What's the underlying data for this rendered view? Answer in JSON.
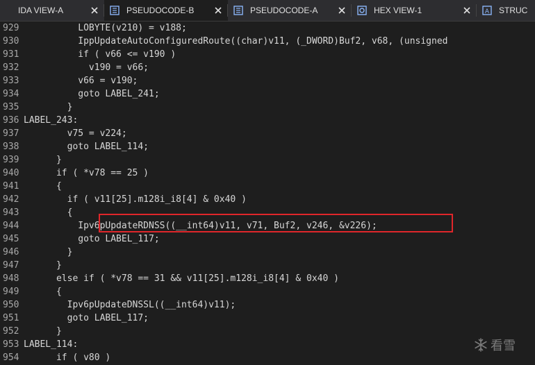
{
  "tabs": [
    {
      "label": "IDA VIEW-A",
      "icon": "ida-view-icon",
      "active": false
    },
    {
      "label": "PSEUDOCODE-B",
      "icon": "pseudocode-icon",
      "active": true
    },
    {
      "label": "PSEUDOCODE-A",
      "icon": "pseudocode-icon",
      "active": false
    },
    {
      "label": "HEX VIEW-1",
      "icon": "hex-view-icon",
      "active": false
    },
    {
      "label": "STRUC",
      "icon": "structures-icon",
      "active": false
    }
  ],
  "code_lines": [
    {
      "n": "929",
      "text": "          LOBYTE(v210) = v188;"
    },
    {
      "n": "930",
      "text": "          IppUpdateAutoConfiguredRoute((char)v11, (_DWORD)Buf2, v68, (unsigned"
    },
    {
      "n": "931",
      "text": "          if ( v66 <= v190 )"
    },
    {
      "n": "932",
      "text": "            v190 = v66;"
    },
    {
      "n": "933",
      "text": "          v66 = v190;"
    },
    {
      "n": "934",
      "text": "          goto LABEL_241;"
    },
    {
      "n": "935",
      "text": "        }"
    },
    {
      "n": "936",
      "text": "LABEL_243:"
    },
    {
      "n": "937",
      "text": "        v75 = v224;"
    },
    {
      "n": "938",
      "text": "        goto LABEL_114;"
    },
    {
      "n": "939",
      "text": "      }"
    },
    {
      "n": "940",
      "text": "      if ( *v78 == 25 )"
    },
    {
      "n": "941",
      "text": "      {"
    },
    {
      "n": "942",
      "text": "        if ( v11[25].m128i_i8[4] & 0x40 )"
    },
    {
      "n": "943",
      "text": "        {"
    },
    {
      "n": "944",
      "text": "          Ipv6pUpdateRDNSS((__int64)v11, v71, Buf2, v246, &v226);"
    },
    {
      "n": "945",
      "text": "          goto LABEL_117;"
    },
    {
      "n": "946",
      "text": "        }"
    },
    {
      "n": "947",
      "text": "      }"
    },
    {
      "n": "948",
      "text": "      else if ( *v78 == 31 && v11[25].m128i_i8[4] & 0x40 )"
    },
    {
      "n": "949",
      "text": "      {"
    },
    {
      "n": "950",
      "text": "        Ipv6pUpdateDNSSL((__int64)v11);"
    },
    {
      "n": "951",
      "text": "        goto LABEL_117;"
    },
    {
      "n": "952",
      "text": "      }"
    },
    {
      "n": "953",
      "text": "LABEL_114:"
    },
    {
      "n": "954",
      "text": "      if ( v80 )"
    }
  ],
  "watermark": {
    "text": "看雪"
  },
  "colors": {
    "background": "#1e1e1e",
    "highlight_border": "#e0262a",
    "code_text": "#d7d7d7",
    "line_number": "#a9a9a9"
  }
}
